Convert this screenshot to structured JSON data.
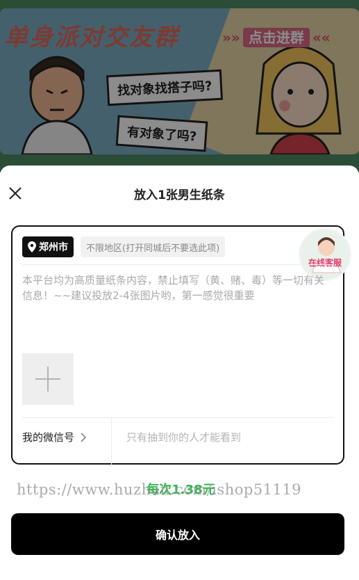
{
  "banner": {
    "title": "单身派对交友群",
    "cta": "点击进群",
    "cta_left": "»»",
    "cta_right": "««",
    "bubble_1": "找对象找搭子吗?",
    "bubble_2": "有对象了吗?"
  },
  "sheet": {
    "title": "放入1张男生纸条",
    "location": "郑州市",
    "area_hint": "不限地区(打开同城后不要选此项)",
    "service_label": "在线客服",
    "content_placeholder": "本平台均为高质量纸条内容，禁止填写（黄、赌、毒）等一切有关信息！~~建议投放2-4张图片哟，第一感觉很重要",
    "wechat_label": "我的微信号",
    "wechat_placeholder": "只有抽到你的人才能看到"
  },
  "price": {
    "label": "每次1.38元"
  },
  "watermark": "https://www.huzhan.com/ishop51119",
  "confirm_label": "确认放入",
  "colors": {
    "accent": "#000000",
    "price": "#2db84d",
    "service": "#e23c6a"
  }
}
